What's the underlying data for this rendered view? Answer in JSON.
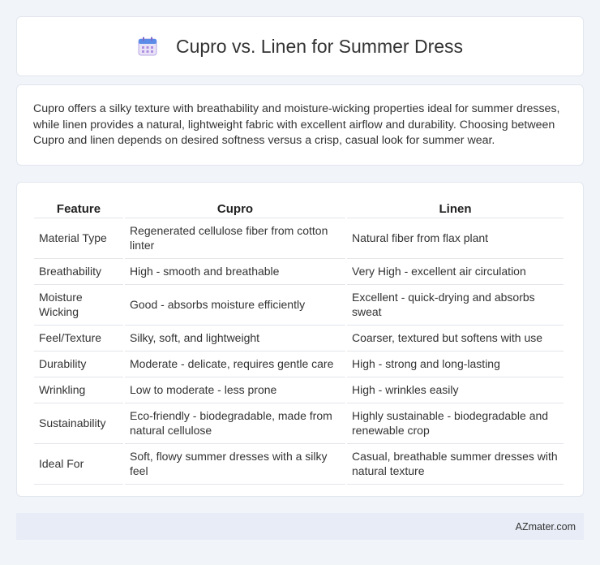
{
  "header": {
    "icon": "calendar-icon",
    "title": "Cupro vs. Linen for Summer Dress"
  },
  "intro": {
    "text": "Cupro offers a silky texture with breathability and moisture-wicking properties ideal for summer dresses, while linen provides a natural, lightweight fabric with excellent airflow and durability. Choosing between Cupro and linen depends on desired softness versus a crisp, casual look for summer wear."
  },
  "table": {
    "headers": [
      "Feature",
      "Cupro",
      "Linen"
    ],
    "rows": [
      [
        "Material Type",
        "Regenerated cellulose fiber from cotton linter",
        "Natural fiber from flax plant"
      ],
      [
        "Breathability",
        "High - smooth and breathable",
        "Very High - excellent air circulation"
      ],
      [
        "Moisture Wicking",
        "Good - absorbs moisture efficiently",
        "Excellent - quick-drying and absorbs sweat"
      ],
      [
        "Feel/Texture",
        "Silky, soft, and lightweight",
        "Coarser, textured but softens with use"
      ],
      [
        "Durability",
        "Moderate - delicate, requires gentle care",
        "High - strong and long-lasting"
      ],
      [
        "Wrinkling",
        "Low to moderate - less prone",
        "High - wrinkles easily"
      ],
      [
        "Sustainability",
        "Eco-friendly - biodegradable, made from natural cellulose",
        "Highly sustainable - biodegradable and renewable crop"
      ],
      [
        "Ideal For",
        "Soft, flowy summer dresses with a silky feel",
        "Casual, breathable summer dresses with natural texture"
      ]
    ]
  },
  "footer": {
    "brand": "AZmater.com"
  }
}
